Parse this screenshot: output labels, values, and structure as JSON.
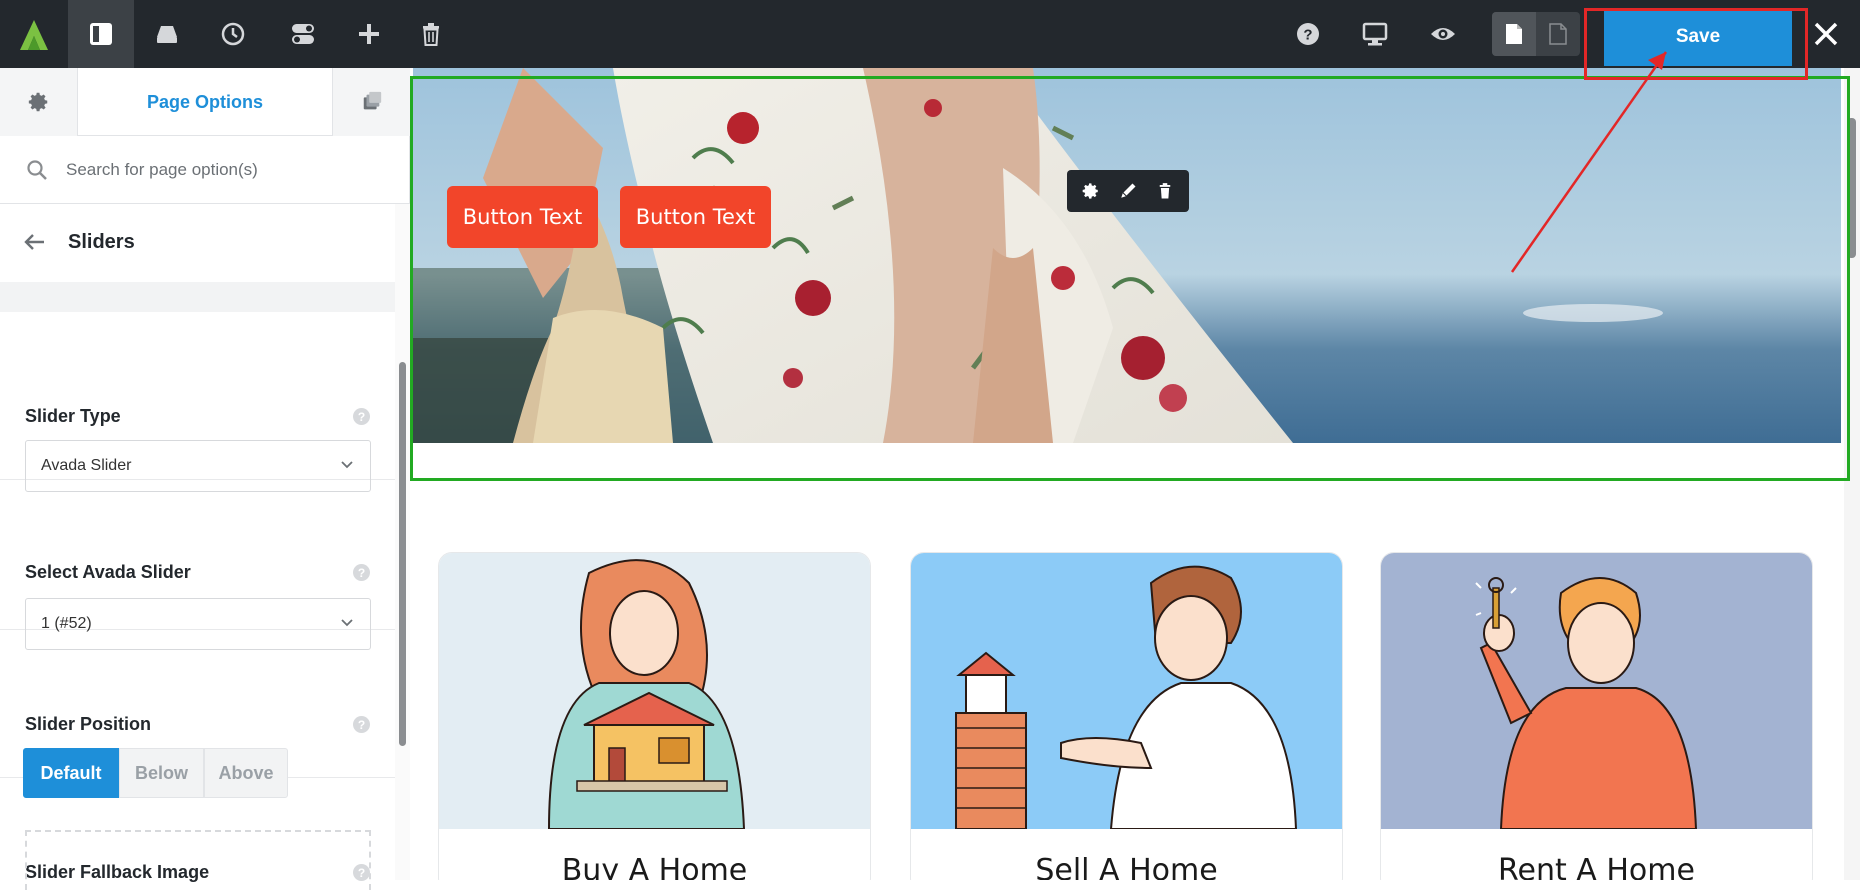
{
  "toolbar": {
    "save_label": "Save",
    "icons": [
      "avada-logo",
      "sidebar-panel-icon",
      "library-icon",
      "history-icon",
      "toggle-icon",
      "add-icon",
      "trash-icon",
      "help-icon",
      "desktop-icon",
      "preview-icon",
      "page-icon",
      "page-outline-icon",
      "close-icon"
    ]
  },
  "sidebar": {
    "tab_label": "Page Options",
    "search_placeholder": "Search for page option(s)",
    "section_title": "Sliders",
    "options": {
      "slider_type": {
        "label": "Slider Type",
        "value": "Avada Slider"
      },
      "select_slider": {
        "label": "Select Avada Slider",
        "value": "1 (#52)"
      },
      "slider_position": {
        "label": "Slider Position",
        "choices": [
          "Default",
          "Below",
          "Above"
        ],
        "selected": "Default"
      },
      "fallback_image": {
        "label": "Slider Fallback Image"
      }
    },
    "help_glyph": "?"
  },
  "canvas": {
    "hero_buttons": [
      "Button Text",
      "Button Text"
    ],
    "cards": [
      {
        "title": "Buy A Home",
        "bg": "#e3edf3"
      },
      {
        "title": "Sell A Home",
        "bg": "#8ccbf7"
      },
      {
        "title": "Rent A Home",
        "bg": "#a3b3d2"
      }
    ]
  },
  "colors": {
    "accent": "#1e8fd9",
    "topbar": "#23282d",
    "hero_button": "#f2452a",
    "annotation_red": "#e32727",
    "annotation_green": "#22aa22"
  }
}
